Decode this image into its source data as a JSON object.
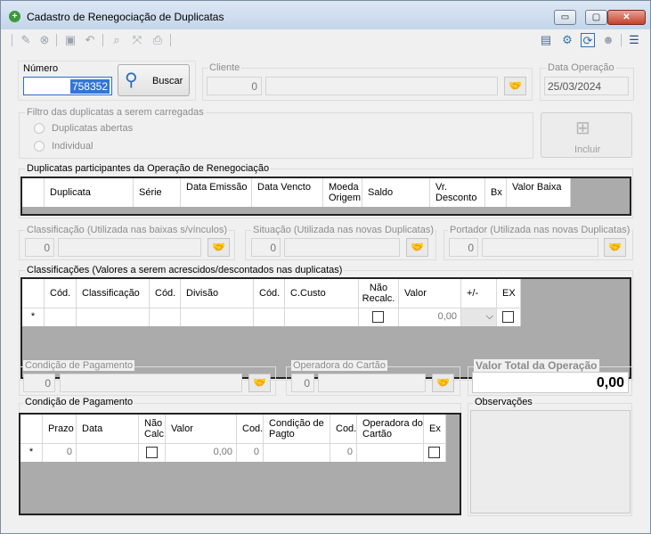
{
  "window": {
    "title": "Cadastro de Renegociação de Duplicatas",
    "min": "▭",
    "max": "▢",
    "close": "✕"
  },
  "top": {
    "numero_label": "Número",
    "numero_value": "758352",
    "buscar_label": "Buscar",
    "cliente_label": "Cliente",
    "cliente_code": "0",
    "data_label": "Data Operação",
    "data_value": "25/03/2024"
  },
  "filtro": {
    "title": "Filtro das duplicatas a serem carregadas",
    "opt1": "Duplicatas abertas",
    "opt2": "Individual",
    "incluir": "Incluir"
  },
  "duplicatas": {
    "title": "Duplicatas participantes da Operação de Renegociação",
    "headers": [
      "Duplicata",
      "Série",
      "Data Emissão",
      "Data Vencto",
      "Moeda Origem",
      "Saldo",
      "Vr. Desconto",
      "Bx",
      "Valor Baixa"
    ]
  },
  "classificacao": {
    "title": "Classificação (Utilizada nas baixas s/vínculos)",
    "code": "0"
  },
  "situacao": {
    "title": "Situação (Utilizada nas novas Duplicatas)",
    "code": "0"
  },
  "portador": {
    "title": "Portador (Utilizada nas novas Duplicatas)",
    "code": "0"
  },
  "classificacoes": {
    "title": "Classificações (Valores a serem acrescidos/descontados nas duplicatas)",
    "headers": [
      "Cód.",
      "Classificação",
      "Cód.",
      "Divisão",
      "Cód.",
      "C.Custo",
      "Não Recalc.",
      "Valor",
      "+/-",
      "EX"
    ],
    "row_marker": "*",
    "row_valor": "0,00"
  },
  "cond_pag_filter": {
    "title": "Condição de Pagamento",
    "code": "0"
  },
  "operadora": {
    "title": "Operadora do Cartão",
    "code": "0"
  },
  "total": {
    "title": "Valor Total da Operação",
    "value": "0,00"
  },
  "condicao": {
    "title": "Condição de Pagamento",
    "headers": [
      "Prazo",
      "Data",
      "Não Calc",
      "Valor",
      "Cod.",
      "Condição de Pagto",
      "Cod.",
      "Operadora do Cartão",
      "Ex"
    ],
    "row_marker": "*",
    "row_prazo": "0",
    "row_valor": "0,00",
    "row_cod1": "0",
    "row_cod2": "0"
  },
  "observacoes": {
    "title": "Observações"
  }
}
